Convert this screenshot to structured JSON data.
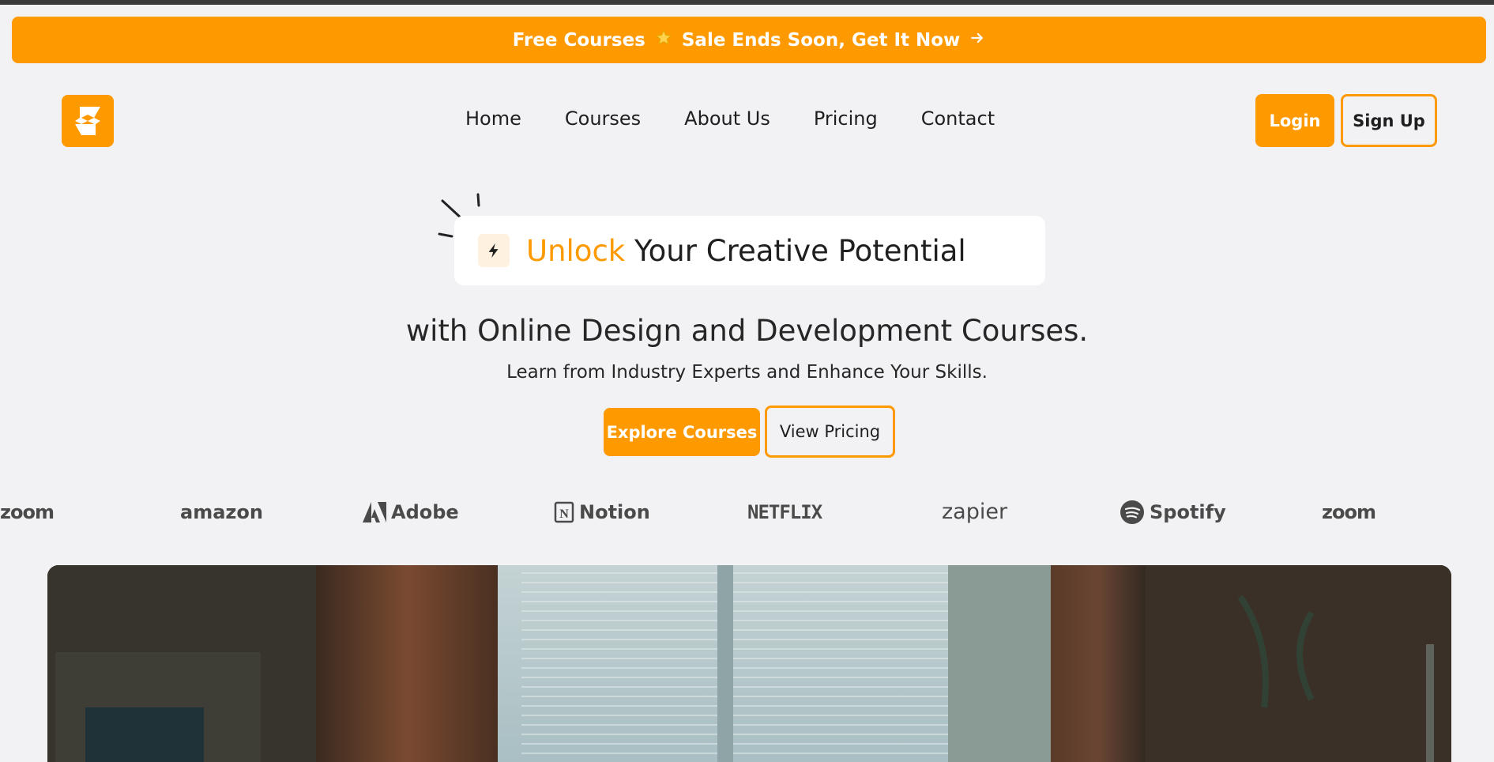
{
  "promo": {
    "left_text": "Free Courses",
    "star_icon": "star-icon",
    "right_text": "Sale Ends Soon, Get It Now",
    "arrow_icon": "arrow-right-icon"
  },
  "brand": {
    "logo_icon": "s-logo-icon",
    "color": "#ff9900"
  },
  "nav": {
    "items": [
      {
        "label": "Home"
      },
      {
        "label": "Courses"
      },
      {
        "label": "About Us"
      },
      {
        "label": "Pricing"
      },
      {
        "label": "Contact"
      }
    ]
  },
  "auth": {
    "login_label": "Login",
    "signup_label": "Sign Up"
  },
  "hero": {
    "title_accent": "Unlock",
    "title_rest": "Your Creative Potential",
    "subtitle": "with Online Design and Development Courses.",
    "tagline": "Learn from Industry Experts and Enhance Your Skills.",
    "primary_cta": "Explore Courses",
    "secondary_cta": "View Pricing"
  },
  "partners": [
    {
      "name": "zoom"
    },
    {
      "name": "amazon"
    },
    {
      "name": "Adobe"
    },
    {
      "name": "Notion"
    },
    {
      "name": "NETFLIX"
    },
    {
      "name": "zapier"
    },
    {
      "name": "Spotify"
    },
    {
      "name": "zoom"
    }
  ]
}
